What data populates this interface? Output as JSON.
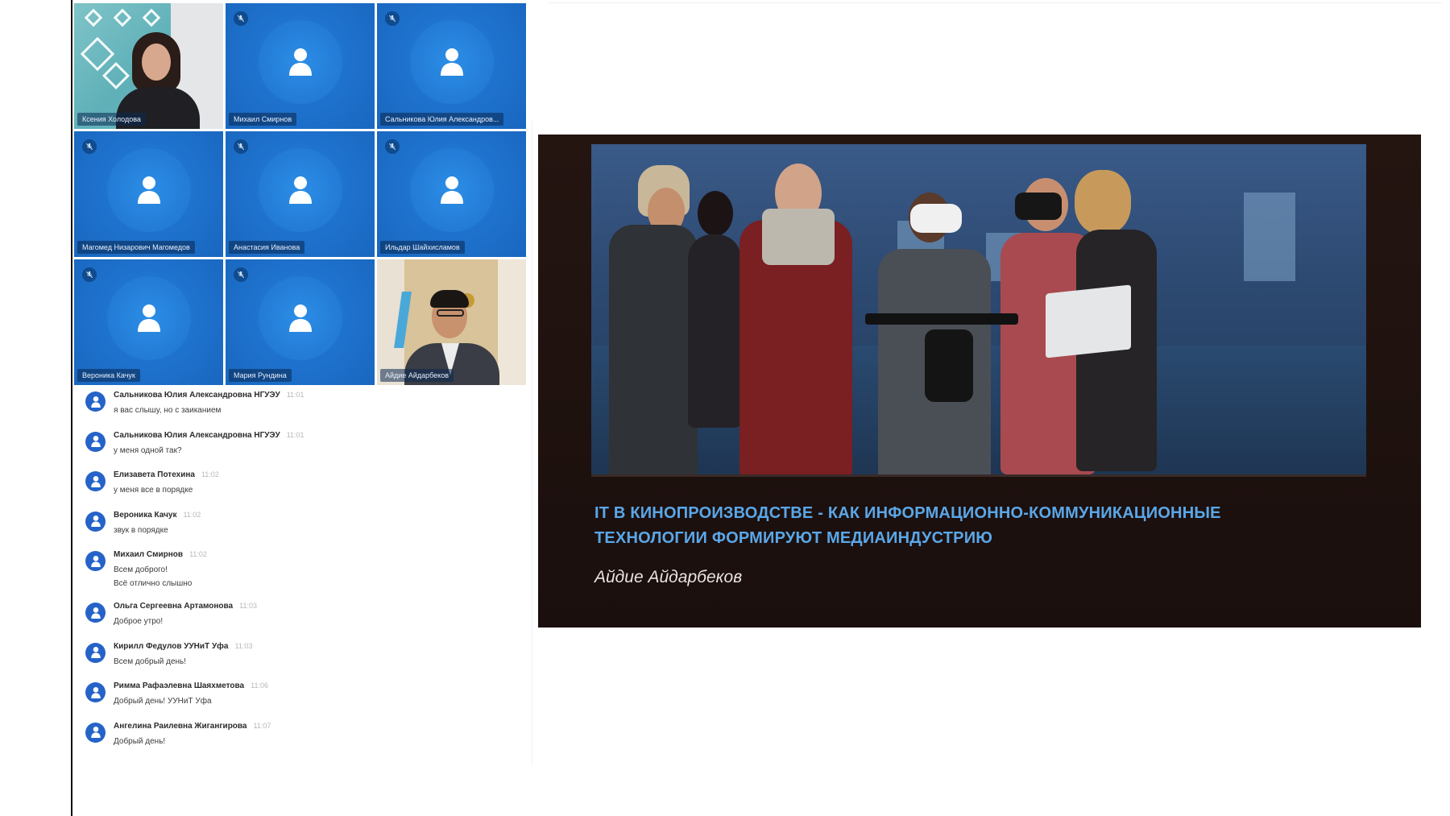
{
  "participants": [
    {
      "name": "Ксения Холодова",
      "type": "camera-woman",
      "muted": false
    },
    {
      "name": "Михаил Смирнов",
      "type": "avatar",
      "muted": true
    },
    {
      "name": "Сальникова Юлия Александров...",
      "type": "avatar",
      "muted": true
    },
    {
      "name": "Магомед Низарович Магомедов",
      "type": "avatar",
      "muted": true
    },
    {
      "name": "Анастасия Иванова",
      "type": "avatar",
      "muted": true
    },
    {
      "name": "Ильдар Шайхисламов",
      "type": "avatar",
      "muted": true
    },
    {
      "name": "Вероника Качук",
      "type": "avatar",
      "muted": true
    },
    {
      "name": "Мария Рундина",
      "type": "avatar",
      "muted": true
    },
    {
      "name": "Айдие Айдарбеков",
      "type": "camera-man",
      "muted": false
    }
  ],
  "chat": [
    {
      "author": "Сальникова Юлия Александровна НГУЭУ",
      "time": "11:01",
      "lines": [
        "я вас слышу, но с заиканием"
      ]
    },
    {
      "author": "Сальникова Юлия Александровна НГУЭУ",
      "time": "11:01",
      "lines": [
        "у меня одной так?"
      ]
    },
    {
      "author": "Елизавета Потехина",
      "time": "11:02",
      "lines": [
        "у меня все в порядке"
      ]
    },
    {
      "author": "Вероника Качук",
      "time": "11:02",
      "lines": [
        "звук в порядке"
      ]
    },
    {
      "author": "Михаил Смирнов",
      "time": "11:02",
      "lines": [
        "Всем доброго!",
        "Всё отлично слышно"
      ]
    },
    {
      "author": "Ольга Сергеевна Артамонова",
      "time": "11:03",
      "lines": [
        "Доброе утро!"
      ]
    },
    {
      "author": "Кирилл Федулов УУНиТ Уфа",
      "time": "11:03",
      "lines": [
        "Всем добрый день!"
      ]
    },
    {
      "author": "Римма Рафаэлевна Шаяхметова",
      "time": "11:06",
      "lines": [
        "Добрый день! УУНиТ Уфа"
      ]
    },
    {
      "author": "Ангелина Раилевна Жигангирова",
      "time": "11:07",
      "lines": [
        "Добрый день!"
      ]
    }
  ],
  "slide": {
    "title_line1": "IT В КИНОПРОИЗВОДСТВЕ - КАК ИНФОРМАЦИОННО-КОММУНИКАЦИОННЫЕ",
    "title_line2": "ТЕХНОЛОГИИ ФОРМИРУЮТ МЕДИАИНДУСТРИЮ",
    "author": "Айдие Айдарбеков"
  },
  "colors": {
    "tile_blue": "#1f74cf",
    "chat_avatar": "#2563c9",
    "slide_title": "#5aa7e8",
    "slide_bg": "#1f120f",
    "active_speaker": "#57c46a"
  },
  "icons": {
    "avatar": "person-silhouette-icon",
    "muted": "microphone-off-icon"
  }
}
